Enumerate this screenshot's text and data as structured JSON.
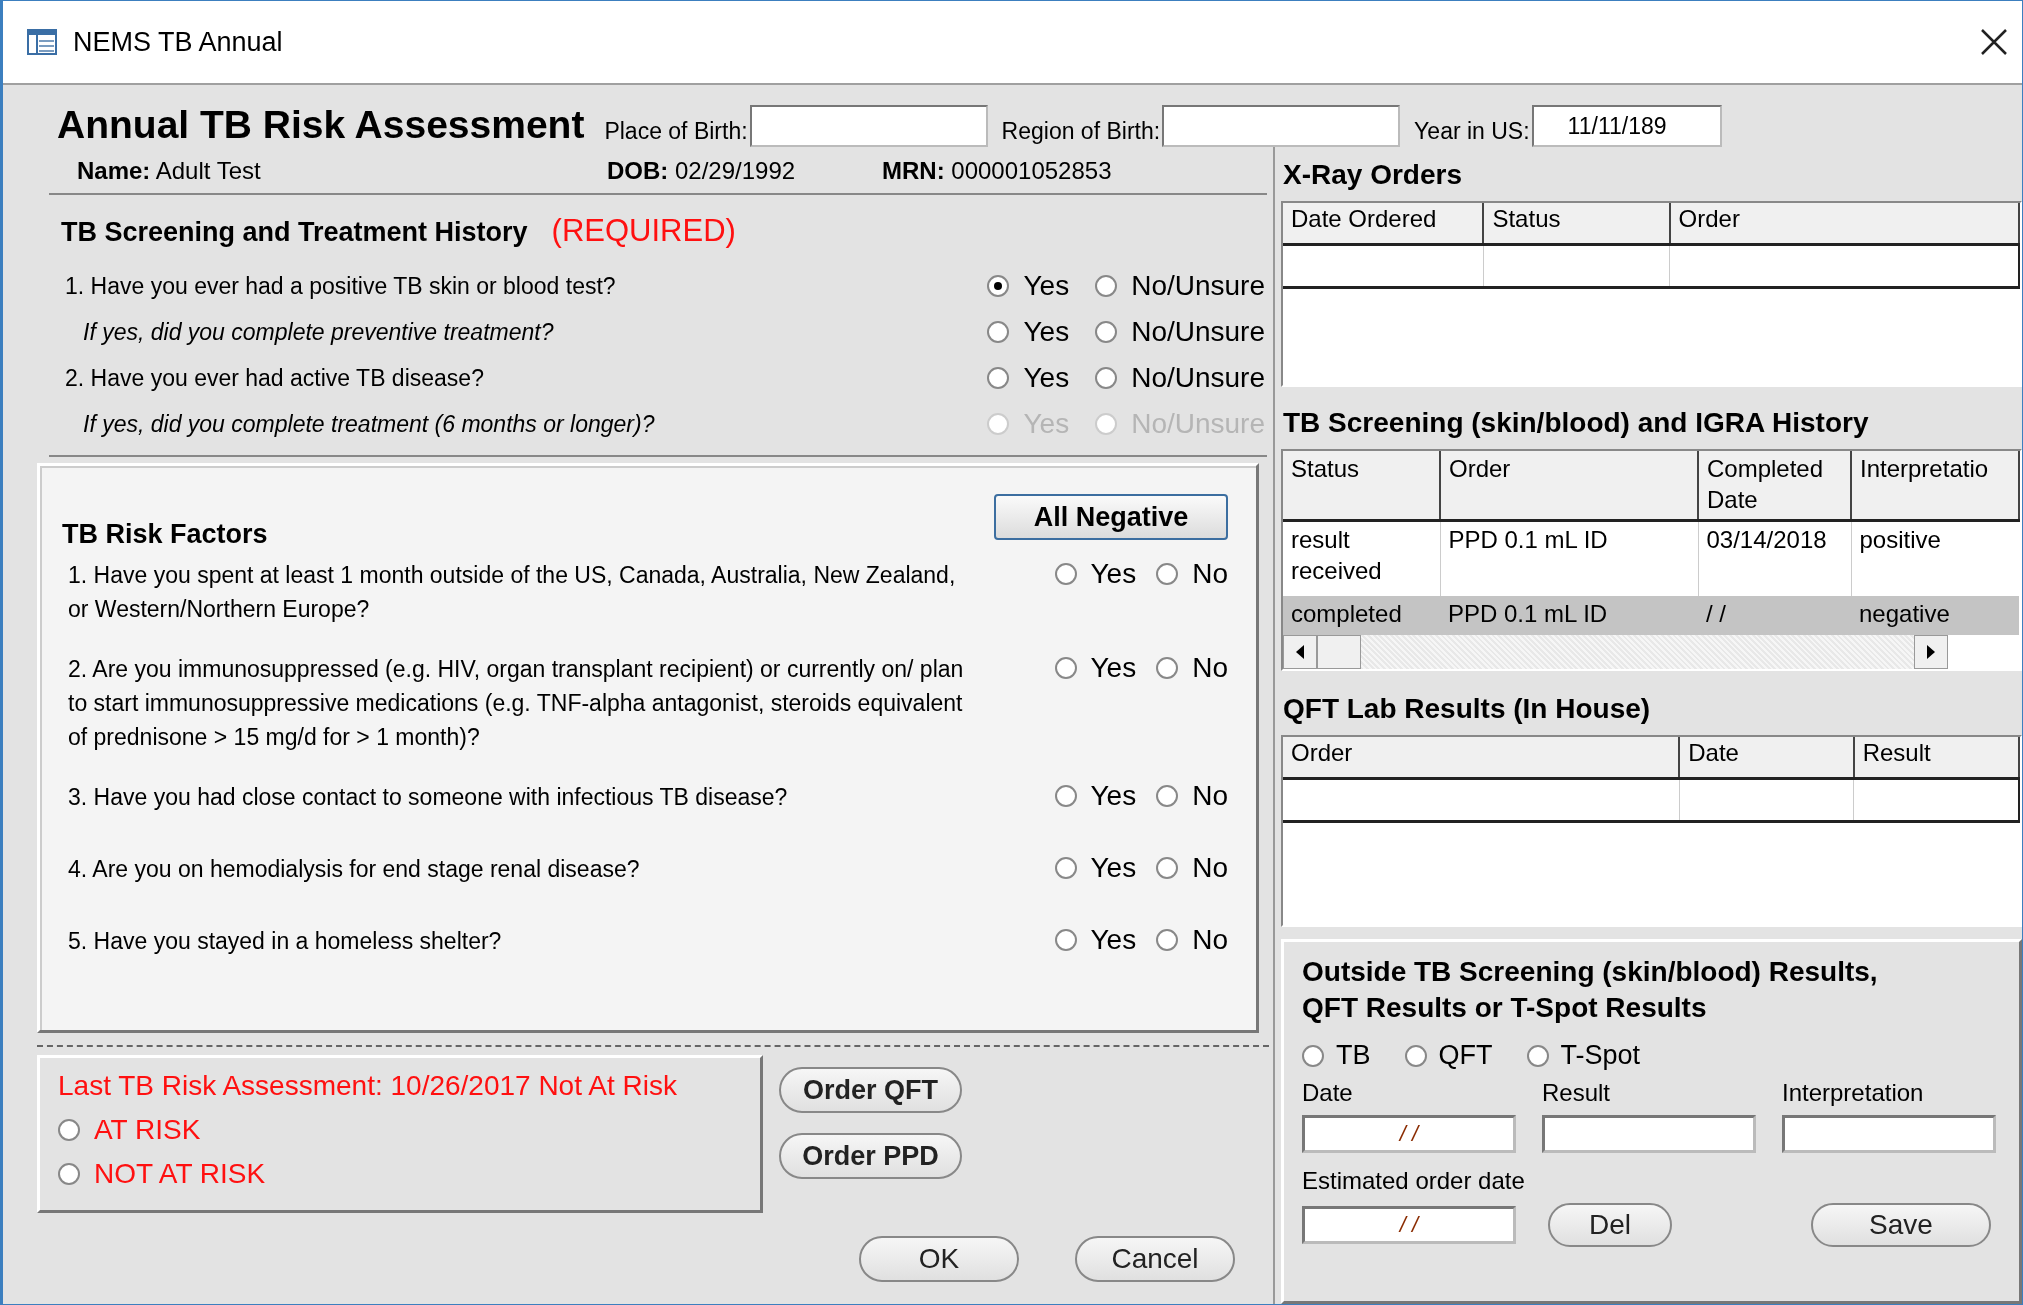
{
  "window": {
    "title": "NEMS TB Annual"
  },
  "header": {
    "title": "Annual TB Risk Assessment",
    "fields": [
      {
        "label": "Place of Birth:"
      },
      {
        "label": "Region of Birth:"
      },
      {
        "label": "Year in US:",
        "value": "11/11/189"
      }
    ]
  },
  "patient": [
    {
      "label": "Name:",
      "value": "Adult Test"
    },
    {
      "label": "DOB:",
      "value": "02/29/1992"
    },
    {
      "label": "MRN:",
      "value": "000001052853"
    }
  ],
  "history": {
    "title": "TB Screening and Treatment History",
    "required": "(REQUIRED)",
    "questions": [
      {
        "kind": "main",
        "text": "1. Have you ever had a positive TB skin or blood test?",
        "disabled": false,
        "options": [
          {
            "label": "Yes",
            "selected": true
          },
          {
            "label": "No/Unsure",
            "selected": false
          }
        ]
      },
      {
        "kind": "followup",
        "text": "If yes, did you complete preventive treatment?",
        "disabled": false,
        "options": [
          {
            "label": "Yes",
            "selected": false
          },
          {
            "label": "No/Unsure",
            "selected": false
          }
        ]
      },
      {
        "kind": "main",
        "text": "2. Have you ever had active TB disease?",
        "disabled": false,
        "options": [
          {
            "label": "Yes",
            "selected": false
          },
          {
            "label": "No/Unsure",
            "selected": false
          }
        ]
      },
      {
        "kind": "followup",
        "text": "If yes, did you complete treatment (6 months or longer)?",
        "disabled": true,
        "options": [
          {
            "label": "Yes",
            "selected": false
          },
          {
            "label": "No/Unsure",
            "selected": false
          }
        ]
      }
    ]
  },
  "risk_factors": {
    "title": "TB Risk Factors",
    "button": "All Negative",
    "questions": [
      {
        "text": "1. Have you spent at least 1 month outside of the US, Canada, Australia, New Zealand, or Western/Northern Europe?",
        "options": [
          {
            "label": "Yes",
            "selected": false
          },
          {
            "label": "No",
            "selected": false
          }
        ]
      },
      {
        "text": "2. Are you immunosuppressed (e.g. HIV, organ transplant recipient) or currently on/ plan to start immunosuppressive medications (e.g. TNF-alpha antagonist, steroids equivalent of prednisone > 15 mg/d for > 1 month)?",
        "options": [
          {
            "label": "Yes",
            "selected": false
          },
          {
            "label": "No",
            "selected": false
          }
        ]
      },
      {
        "text": "3. Have you had close contact to someone with infectious TB disease?",
        "options": [
          {
            "label": "Yes",
            "selected": false
          },
          {
            "label": "No",
            "selected": false
          }
        ]
      },
      {
        "text": "4. Are you on hemodialysis for end stage renal disease?",
        "options": [
          {
            "label": "Yes",
            "selected": false
          },
          {
            "label": "No",
            "selected": false
          }
        ]
      },
      {
        "text": "5. Have you stayed in a homeless shelter?",
        "options": [
          {
            "label": "Yes",
            "selected": false
          },
          {
            "label": "No",
            "selected": false
          }
        ]
      }
    ]
  },
  "assessment": {
    "last": "Last TB Risk Assessment: 10/26/2017 Not At Risk",
    "options": [
      {
        "label": "AT RISK",
        "selected": false
      },
      {
        "label": "NOT AT RISK",
        "selected": false
      }
    ]
  },
  "order_buttons": [
    "Order QFT",
    "Order PPD"
  ],
  "dialog_buttons": [
    "OK",
    "Cancel"
  ],
  "xray": {
    "title": "X-Ray Orders",
    "columns": [
      "Date Ordered",
      "Status",
      "Order"
    ]
  },
  "screening_history": {
    "title": "TB Screening (skin/blood) and IGRA History",
    "columns": [
      "Status",
      "Order",
      "Completed Date",
      "Interpretatio"
    ],
    "rows": [
      {
        "cells": [
          "result received",
          "PPD 0.1 mL ID",
          "03/14/2018",
          "positive"
        ],
        "selected": false
      },
      {
        "cells": [
          "completed",
          "PPD 0.1 mL ID",
          "/ /",
          "negative"
        ],
        "selected": true
      }
    ]
  },
  "qft": {
    "title": "QFT Lab Results (In House)",
    "columns": [
      "Order",
      "Date",
      "Result"
    ]
  },
  "outside": {
    "title": [
      "Outside TB Screening (skin/blood) Results,",
      "QFT Results or T-Spot Results"
    ],
    "types": [
      {
        "label": "TB",
        "selected": false
      },
      {
        "label": "QFT",
        "selected": false
      },
      {
        "label": "T-Spot",
        "selected": false
      }
    ],
    "fields": [
      {
        "label": "Date",
        "value": "/ /"
      },
      {
        "label": "Result"
      },
      {
        "label": "Interpretation"
      }
    ],
    "estimated": {
      "label": "Estimated order date",
      "value": "/ /"
    },
    "buttons": [
      "Del",
      "Save"
    ]
  }
}
